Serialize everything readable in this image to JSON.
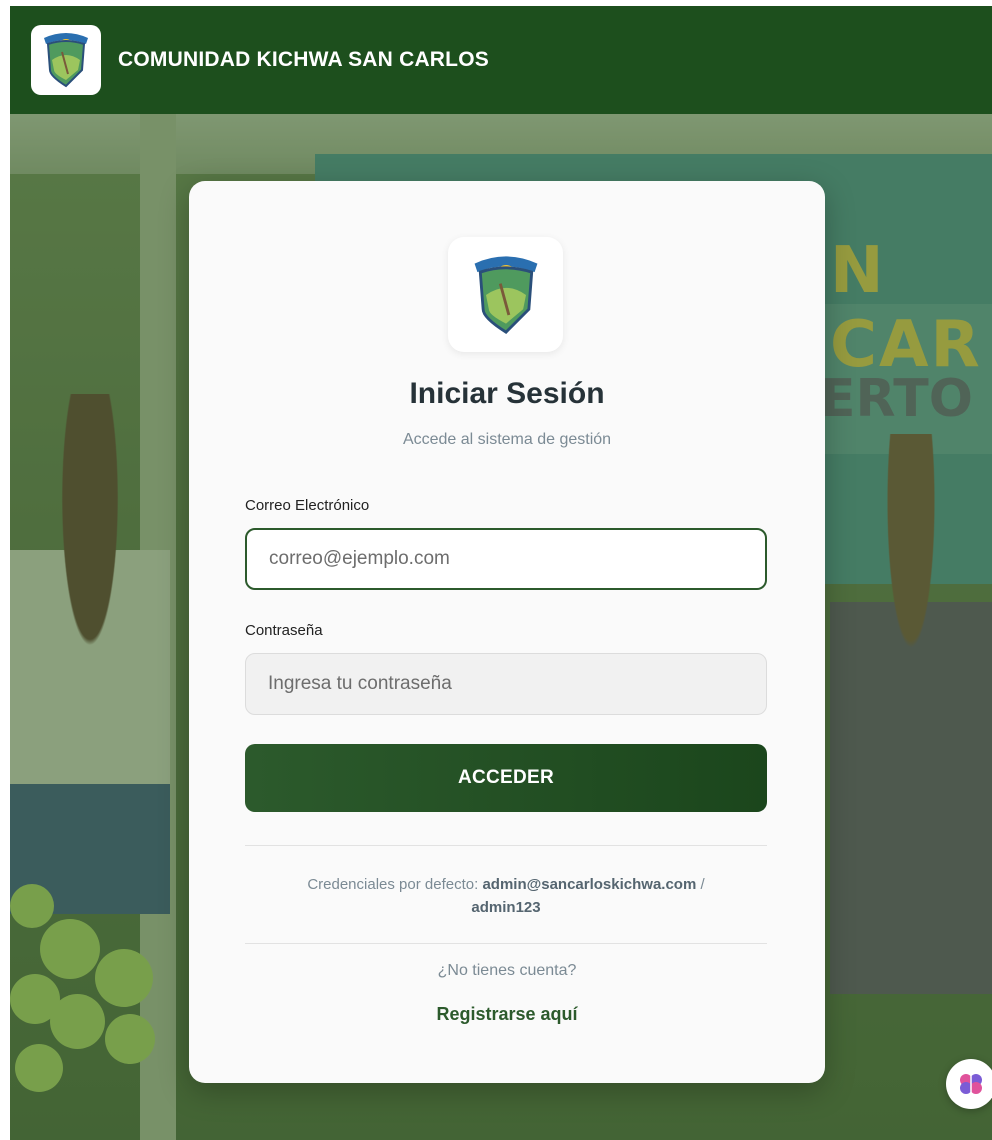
{
  "header": {
    "title": "COMUNIDAD KICHWA SAN CARLOS",
    "logo_icon": "community-shield-logo"
  },
  "background": {
    "banner_text_1": "N CAR",
    "banner_text_2": "ERTO"
  },
  "login": {
    "title": "Iniciar Sesión",
    "subtitle": "Accede al sistema de gestión",
    "email_label": "Correo Electrónico",
    "email_placeholder": "correo@ejemplo.com",
    "email_value": "",
    "password_label": "Contraseña",
    "password_placeholder": "Ingresa tu contraseña",
    "password_value": "",
    "submit_label": "ACCEDER",
    "credentials_prefix": "Credenciales por defecto:",
    "credentials_email": "admin@sancarloskichwa.com",
    "credentials_separator": "/",
    "credentials_password": "admin123",
    "no_account": "¿No tienes cuenta?",
    "register_link": "Registrarse aquí"
  },
  "floating_button": {
    "icon": "brain-icon"
  },
  "colors": {
    "primary": "#1d4f1d",
    "button": "#2c5a2c",
    "card": "#fafafa",
    "muted_text": "#7b8a94"
  }
}
